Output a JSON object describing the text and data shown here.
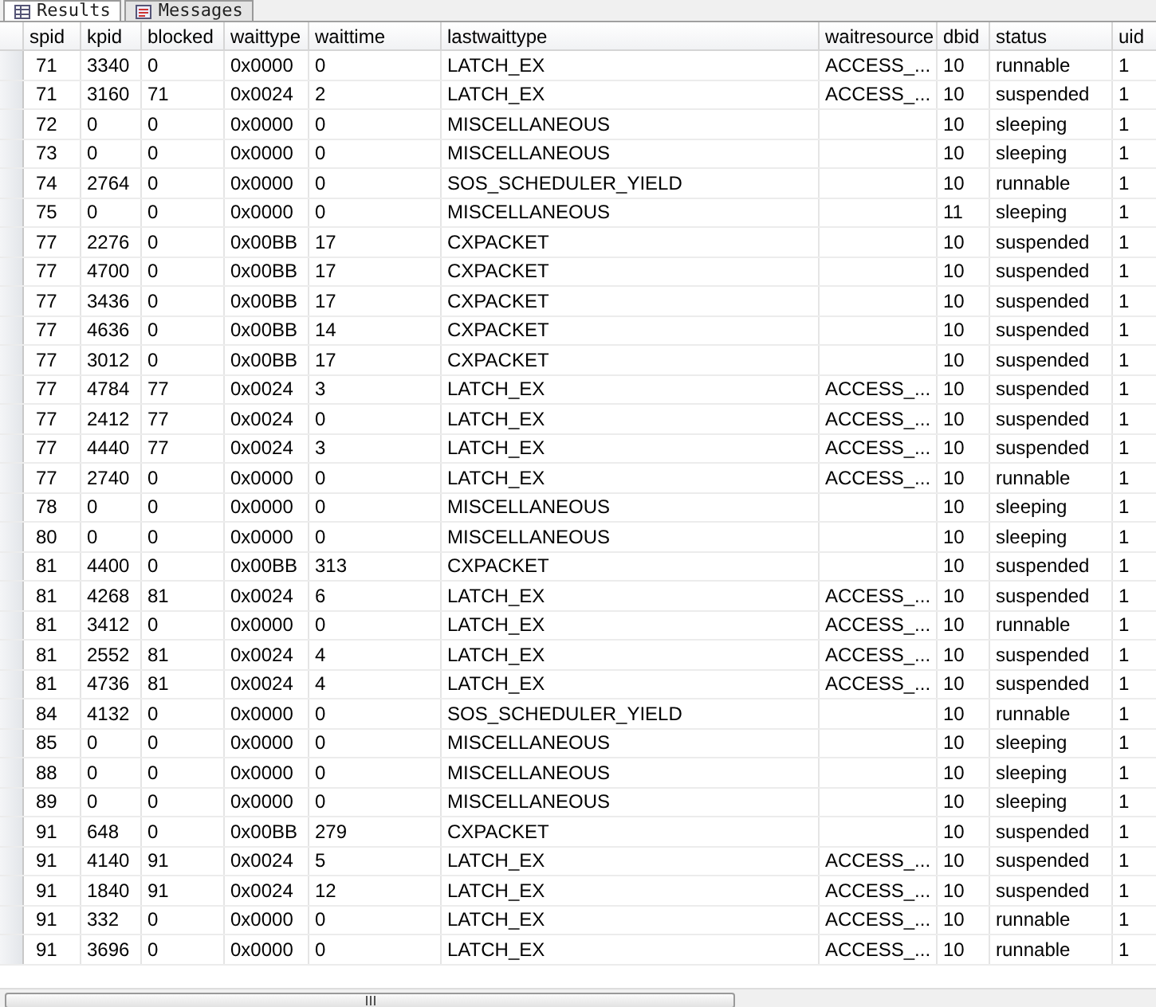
{
  "tabs": [
    {
      "label": "Results",
      "selected": true
    },
    {
      "label": "Messages",
      "selected": false
    }
  ],
  "table": {
    "columns": [
      "spid",
      "kpid",
      "blocked",
      "waittype",
      "waittime",
      "lastwaittype",
      "waitresource",
      "dbid",
      "status",
      "uid"
    ],
    "rows": [
      [
        "71",
        "3340",
        "0",
        "0x0000",
        "0",
        "LATCH_EX",
        "ACCESS_...",
        "10",
        "runnable",
        "1"
      ],
      [
        "71",
        "3160",
        "71",
        "0x0024",
        "2",
        "LATCH_EX",
        "ACCESS_...",
        "10",
        "suspended",
        "1"
      ],
      [
        "72",
        "0",
        "0",
        "0x0000",
        "0",
        "MISCELLANEOUS",
        null,
        "10",
        "sleeping",
        "1"
      ],
      [
        "73",
        "0",
        "0",
        "0x0000",
        "0",
        "MISCELLANEOUS",
        null,
        "10",
        "sleeping",
        "1"
      ],
      [
        "74",
        "2764",
        "0",
        "0x0000",
        "0",
        "SOS_SCHEDULER_YIELD",
        null,
        "10",
        "runnable",
        "1"
      ],
      [
        "75",
        "0",
        "0",
        "0x0000",
        "0",
        "MISCELLANEOUS",
        null,
        "11",
        "sleeping",
        "1"
      ],
      [
        "77",
        "2276",
        "0",
        "0x00BB",
        "17",
        "CXPACKET",
        null,
        "10",
        "suspended",
        "1"
      ],
      [
        "77",
        "4700",
        "0",
        "0x00BB",
        "17",
        "CXPACKET",
        null,
        "10",
        "suspended",
        "1"
      ],
      [
        "77",
        "3436",
        "0",
        "0x00BB",
        "17",
        "CXPACKET",
        null,
        "10",
        "suspended",
        "1"
      ],
      [
        "77",
        "4636",
        "0",
        "0x00BB",
        "14",
        "CXPACKET",
        null,
        "10",
        "suspended",
        "1"
      ],
      [
        "77",
        "3012",
        "0",
        "0x00BB",
        "17",
        "CXPACKET",
        null,
        "10",
        "suspended",
        "1"
      ],
      [
        "77",
        "4784",
        "77",
        "0x0024",
        "3",
        "LATCH_EX",
        "ACCESS_...",
        "10",
        "suspended",
        "1"
      ],
      [
        "77",
        "2412",
        "77",
        "0x0024",
        "0",
        "LATCH_EX",
        "ACCESS_...",
        "10",
        "suspended",
        "1"
      ],
      [
        "77",
        "4440",
        "77",
        "0x0024",
        "3",
        "LATCH_EX",
        "ACCESS_...",
        "10",
        "suspended",
        "1"
      ],
      [
        "77",
        "2740",
        "0",
        "0x0000",
        "0",
        "LATCH_EX",
        "ACCESS_...",
        "10",
        "runnable",
        "1"
      ],
      [
        "78",
        "0",
        "0",
        "0x0000",
        "0",
        "MISCELLANEOUS",
        null,
        "10",
        "sleeping",
        "1"
      ],
      [
        "80",
        "0",
        "0",
        "0x0000",
        "0",
        "MISCELLANEOUS",
        null,
        "10",
        "sleeping",
        "1"
      ],
      [
        "81",
        "4400",
        "0",
        "0x00BB",
        "313",
        "CXPACKET",
        null,
        "10",
        "suspended",
        "1"
      ],
      [
        "81",
        "4268",
        "81",
        "0x0024",
        "6",
        "LATCH_EX",
        "ACCESS_...",
        "10",
        "suspended",
        "1"
      ],
      [
        "81",
        "3412",
        "0",
        "0x0000",
        "0",
        "LATCH_EX",
        "ACCESS_...",
        "10",
        "runnable",
        "1"
      ],
      [
        "81",
        "2552",
        "81",
        "0x0024",
        "4",
        "LATCH_EX",
        "ACCESS_...",
        "10",
        "suspended",
        "1"
      ],
      [
        "81",
        "4736",
        "81",
        "0x0024",
        "4",
        "LATCH_EX",
        "ACCESS_...",
        "10",
        "suspended",
        "1"
      ],
      [
        "84",
        "4132",
        "0",
        "0x0000",
        "0",
        "SOS_SCHEDULER_YIELD",
        null,
        "10",
        "runnable",
        "1"
      ],
      [
        "85",
        "0",
        "0",
        "0x0000",
        "0",
        "MISCELLANEOUS",
        null,
        "10",
        "sleeping",
        "1"
      ],
      [
        "88",
        "0",
        "0",
        "0x0000",
        "0",
        "MISCELLANEOUS",
        null,
        "10",
        "sleeping",
        "1"
      ],
      [
        "89",
        "0",
        "0",
        "0x0000",
        "0",
        "MISCELLANEOUS",
        null,
        "10",
        "sleeping",
        "1"
      ],
      [
        "91",
        "648",
        "0",
        "0x00BB",
        "279",
        "CXPACKET",
        null,
        "10",
        "suspended",
        "1"
      ],
      [
        "91",
        "4140",
        "91",
        "0x0024",
        "5",
        "LATCH_EX",
        "ACCESS_...",
        "10",
        "suspended",
        "1"
      ],
      [
        "91",
        "1840",
        "91",
        "0x0024",
        "12",
        "LATCH_EX",
        "ACCESS_...",
        "10",
        "suspended",
        "1"
      ],
      [
        "91",
        "332",
        "0",
        "0x0000",
        "0",
        "LATCH_EX",
        "ACCESS_...",
        "10",
        "runnable",
        "1"
      ],
      [
        "91",
        "3696",
        "0",
        "0x0000",
        "0",
        "LATCH_EX",
        "ACCESS_...",
        "10",
        "runnable",
        "1"
      ]
    ]
  }
}
